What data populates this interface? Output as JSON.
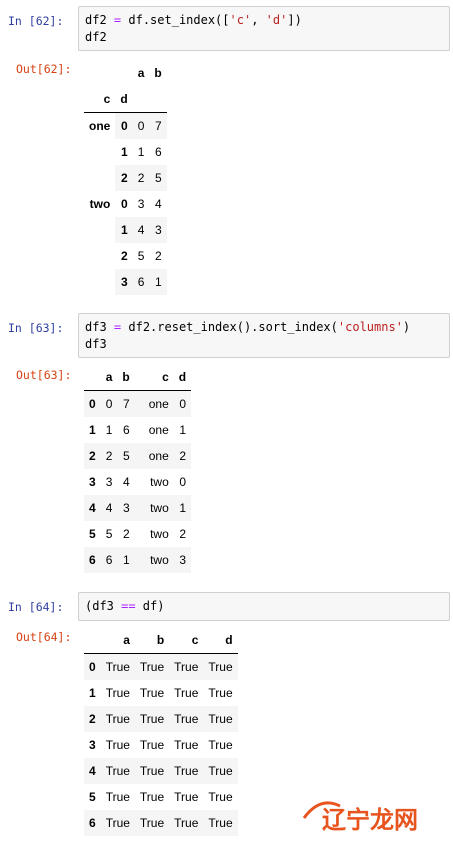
{
  "cells": [
    {
      "in_prompt": "In  [62]:",
      "code": [
        "df2 = df.set_index(['c', 'd'])",
        "df2"
      ],
      "out_prompt": "Out[62]:",
      "table": {
        "columns": [
          "a",
          "b"
        ],
        "index_names": [
          "c",
          "d"
        ],
        "rows": [
          {
            "c": "one",
            "d": "0",
            "vals": [
              "0",
              "7"
            ]
          },
          {
            "c": "",
            "d": "1",
            "vals": [
              "1",
              "6"
            ]
          },
          {
            "c": "",
            "d": "2",
            "vals": [
              "2",
              "5"
            ]
          },
          {
            "c": "two",
            "d": "0",
            "vals": [
              "3",
              "4"
            ]
          },
          {
            "c": "",
            "d": "1",
            "vals": [
              "4",
              "3"
            ]
          },
          {
            "c": "",
            "d": "2",
            "vals": [
              "5",
              "2"
            ]
          },
          {
            "c": "",
            "d": "3",
            "vals": [
              "6",
              "1"
            ]
          }
        ]
      }
    },
    {
      "in_prompt": "In  [63]:",
      "code": [
        "df3 = df2.reset_index().sort_index('columns')",
        "df3"
      ],
      "out_prompt": "Out[63]:",
      "table": {
        "columns": [
          "a",
          "b",
          "c",
          "d"
        ],
        "rows": [
          {
            "idx": "0",
            "vals": [
              "0",
              "7",
              "one",
              "0"
            ]
          },
          {
            "idx": "1",
            "vals": [
              "1",
              "6",
              "one",
              "1"
            ]
          },
          {
            "idx": "2",
            "vals": [
              "2",
              "5",
              "one",
              "2"
            ]
          },
          {
            "idx": "3",
            "vals": [
              "3",
              "4",
              "two",
              "0"
            ]
          },
          {
            "idx": "4",
            "vals": [
              "4",
              "3",
              "two",
              "1"
            ]
          },
          {
            "idx": "5",
            "vals": [
              "5",
              "2",
              "two",
              "2"
            ]
          },
          {
            "idx": "6",
            "vals": [
              "6",
              "1",
              "two",
              "3"
            ]
          }
        ]
      }
    },
    {
      "in_prompt": "In  [64]:",
      "code": [
        "(df3 == df)"
      ],
      "out_prompt": "Out[64]:",
      "table": {
        "columns": [
          "a",
          "b",
          "c",
          "d"
        ],
        "rows": [
          {
            "idx": "0",
            "vals": [
              "True",
              "True",
              "True",
              "True"
            ]
          },
          {
            "idx": "1",
            "vals": [
              "True",
              "True",
              "True",
              "True"
            ]
          },
          {
            "idx": "2",
            "vals": [
              "True",
              "True",
              "True",
              "True"
            ]
          },
          {
            "idx": "3",
            "vals": [
              "True",
              "True",
              "True",
              "True"
            ]
          },
          {
            "idx": "4",
            "vals": [
              "True",
              "True",
              "True",
              "True"
            ]
          },
          {
            "idx": "5",
            "vals": [
              "True",
              "True",
              "True",
              "True"
            ]
          },
          {
            "idx": "6",
            "vals": [
              "True",
              "True",
              "True",
              "True"
            ]
          }
        ]
      }
    }
  ],
  "watermark": {
    "text": "辽宁龙网",
    "color": "#e8541e"
  },
  "colors": {
    "in_prompt": "#303f9f",
    "out_prompt": "#d84315",
    "operator": "#aa22ff",
    "string": "#ba2121"
  }
}
